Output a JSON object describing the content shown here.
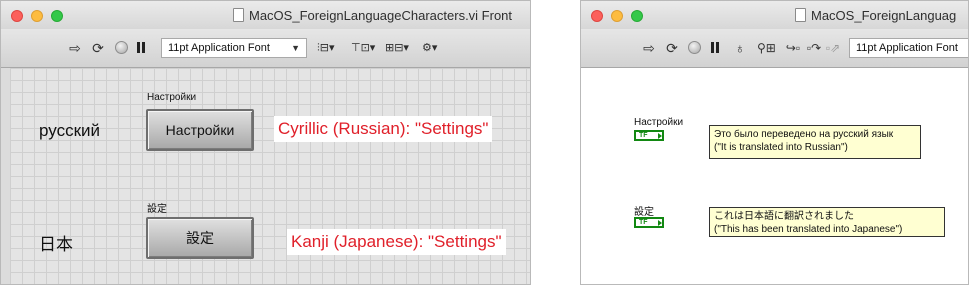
{
  "front_panel": {
    "title": "MacOS_ForeignLanguageCharacters.vi Front",
    "toolbar": {
      "run_icon": "run-arrow-icon",
      "font_dropdown": "11pt Application Font",
      "icons": [
        "run-arrow-icon",
        "run-continuously-icon",
        "abort-icon",
        "pause-icon",
        "align-objects-icon",
        "distribute-objects-icon",
        "resize-objects-icon",
        "reorder-icon"
      ]
    },
    "controls": [
      {
        "caption": "русский",
        "label": "Настройки",
        "button_text": "Настройки",
        "annotation": "Cyrillic (Russian): \"Settings\""
      },
      {
        "caption": "日本",
        "label": "設定",
        "button_text": "設定",
        "annotation": "Kanji (Japanese): \"Settings\""
      }
    ],
    "annotation_color": "#e0202a"
  },
  "block_diagram": {
    "title": "MacOS_ForeignLanguag",
    "toolbar": {
      "font_dropdown": "11pt Application Font",
      "icons": [
        "run-arrow-icon",
        "run-continuously-icon",
        "abort-icon",
        "pause-icon",
        "highlight-execution-icon",
        "retain-wire-values-icon",
        "step-into-icon",
        "step-over-icon",
        "step-out-icon"
      ]
    },
    "terminals": [
      {
        "label": "Настройки",
        "type_text": "TF",
        "comment_line1": "Это было переведено на русский язык",
        "comment_line2": "(\"It is translated into Russian\")"
      },
      {
        "label": "設定",
        "type_text": "TF",
        "comment_line1": "これは日本語に翻訳されました",
        "comment_line2": "(\"This has been translated into Japanese\")"
      }
    ],
    "terminal_color": "#128812",
    "comment_bg": "#ffffd2"
  }
}
